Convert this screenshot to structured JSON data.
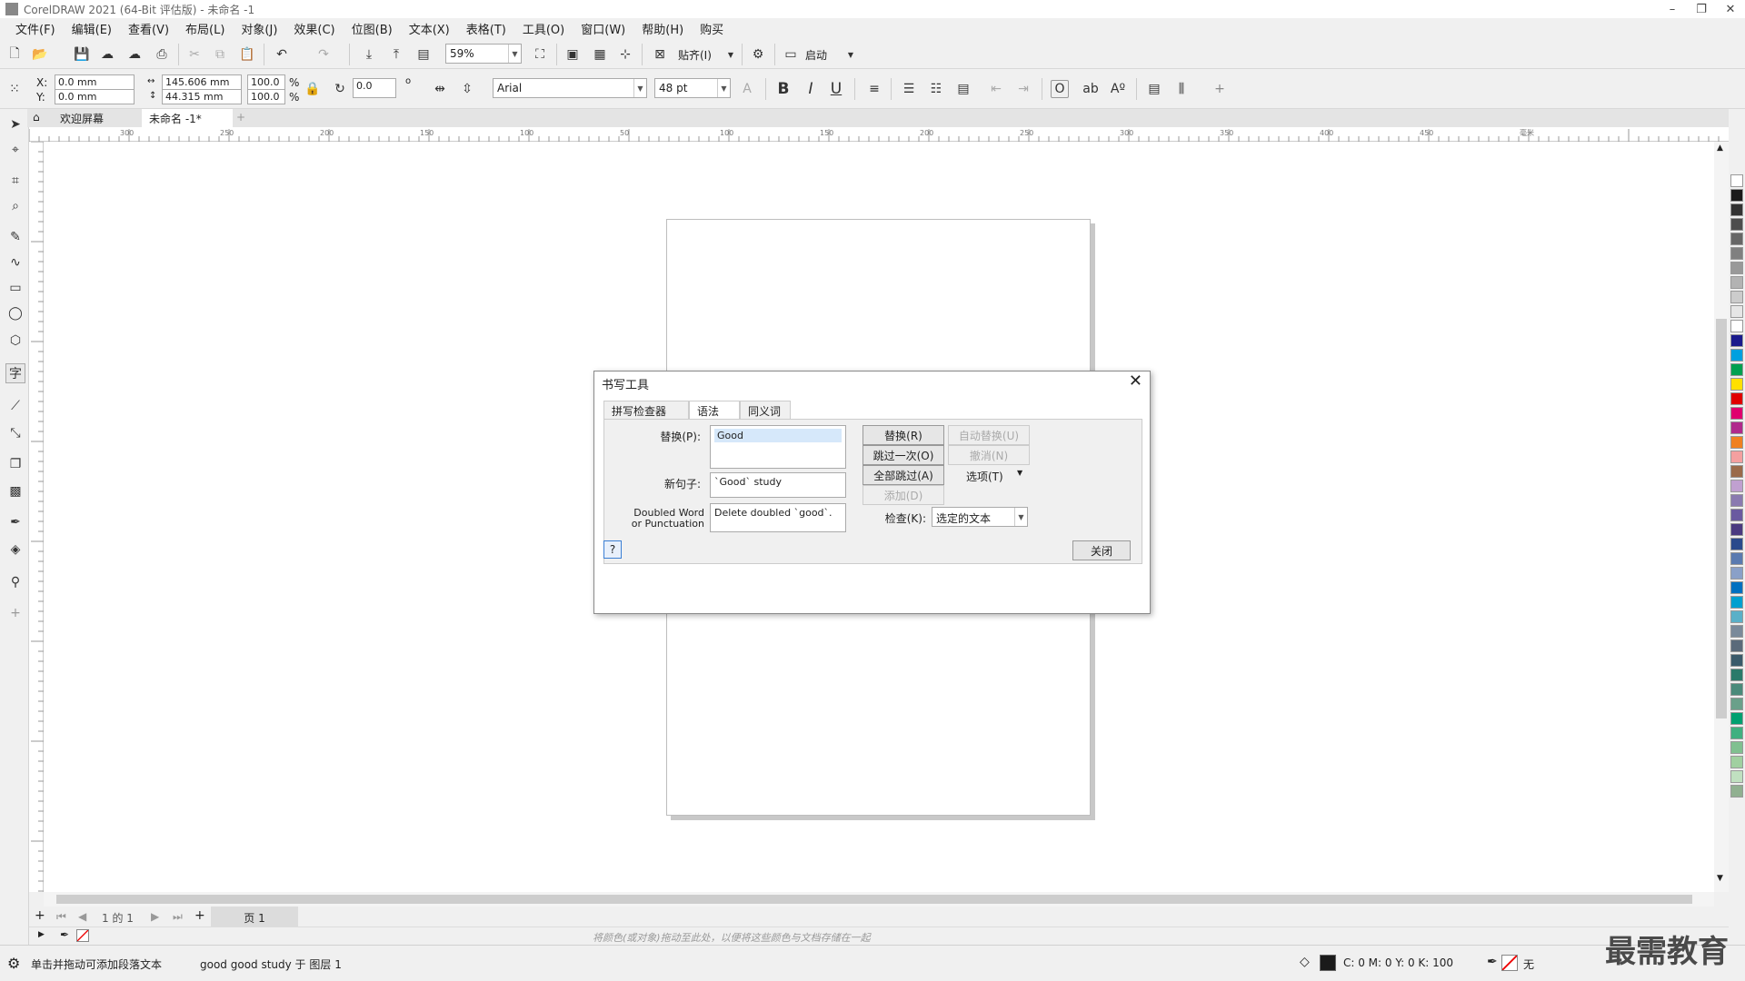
{
  "window": {
    "title": "CorelDRAW 2021 (64-Bit 评估版) - 未命名 -1"
  },
  "menu": [
    "文件(F)",
    "编辑(E)",
    "查看(V)",
    "布局(L)",
    "对象(J)",
    "效果(C)",
    "位图(B)",
    "文本(X)",
    "表格(T)",
    "工具(O)",
    "窗口(W)",
    "帮助(H)",
    "购买"
  ],
  "toolbar1": {
    "zoom": "59%",
    "snap_label": "贴齐(I)",
    "launch_label": "启动"
  },
  "toolbar2": {
    "x_label": "X:",
    "x_value": "0.0 mm",
    "y_label": "Y:",
    "y_value": "0.0 mm",
    "width_value": "145.606 mm",
    "height_value": "44.315 mm",
    "scale_w": "100.0",
    "scale_h": "100.0",
    "percent": "%",
    "rotation": "0.0",
    "degree": "o",
    "font": "Arial",
    "font_size": "48 pt",
    "bold": "B",
    "italic": "I",
    "underline": "U"
  },
  "doc_tabs": [
    "欢迎屏幕",
    "未命名 -1*"
  ],
  "ruler_h_ticks": [
    "300",
    "250",
    "200",
    "150",
    "100",
    "50",
    "100",
    "150",
    "200",
    "250",
    "300",
    "350",
    "400",
    "450",
    "毫米"
  ],
  "page_nav": {
    "page_of": "1  的  1",
    "page_tab": "页 1"
  },
  "color_strip_hint": "将颜色(或对象)拖动至此处，以便将这些颜色与文档存储在一起",
  "status": {
    "hint": "单击并拖动可添加段落文本",
    "object_info": "good good study 于 图层 1",
    "fill_info": "C: 0 M: 0 Y: 0 K: 100",
    "outline": "无"
  },
  "watermark": "最需教育",
  "dialog": {
    "title": "书写工具",
    "tabs": [
      "拼写检查器",
      "语法",
      "同义词"
    ],
    "replace_label": "替换(P):",
    "replace_value": "Good",
    "new_sentence_label": "新句子:",
    "new_sentence_value": "`Good` study",
    "rule_label_1": "Doubled Word",
    "rule_label_2": "or Punctuation",
    "rule_value": "Delete doubled `good`.",
    "buttons": {
      "replace": "替换(R)",
      "auto_replace": "自动替换(U)",
      "skip_once": "跳过一次(O)",
      "undo": "撤消(N)",
      "skip_all": "全部跳过(A)",
      "options": "选项(T)",
      "add": "添加(D)"
    },
    "check_label": "检查(K):",
    "check_value": "选定的文本",
    "help": "?",
    "close": "关闭"
  },
  "palette_colors": [
    "#ffffff",
    "#1a1a1a",
    "#333333",
    "#4d4d4d",
    "#666666",
    "#808080",
    "#999999",
    "#b3b3b3",
    "#cccccc",
    "#e6e6e6",
    "#ffffff",
    "#1a1a8c",
    "#00a0e0",
    "#00a050",
    "#ffe000",
    "#e00000",
    "#e0006e",
    "#b02a8c",
    "#f08020",
    "#f4a0a0",
    "#9a6a4a",
    "#c0a0d0",
    "#8a7ab0",
    "#6a5aa0",
    "#4a3a80",
    "#2a4a8c",
    "#5a7ab0",
    "#8aa0c8",
    "#0070c0",
    "#00a0d0",
    "#5ab0c8",
    "#7a8a9a",
    "#5a6a7a",
    "#3a5a6a",
    "#2a7a6a",
    "#4a8a7a",
    "#6aa08a",
    "#00a070",
    "#40b080",
    "#80c090",
    "#a0d0a0",
    "#c0e0c0",
    "#90b090"
  ]
}
